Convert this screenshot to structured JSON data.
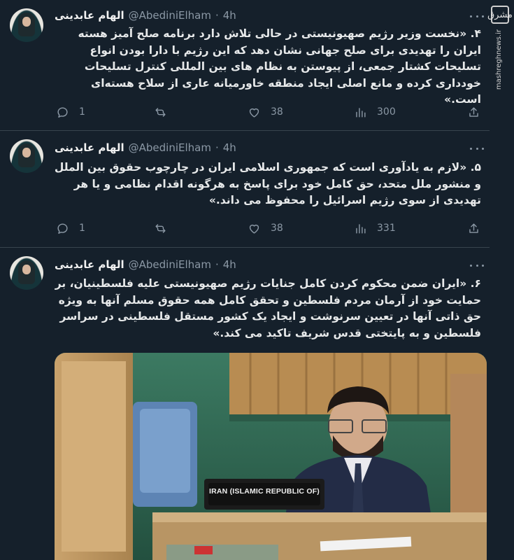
{
  "watermark": {
    "logo_text": "مشرق",
    "site": "mashreghnews.ir"
  },
  "tweets": [
    {
      "author_name": "الهام عابدینی",
      "handle": "@AbediniElham",
      "separator": "·",
      "time": "4h",
      "text": "۴. «نخست وزیر رژیم صهیونیستی در حالی تلاش دارد برنامه صلح آمیز هسته ایران را تهدیدی برای صلح جهانی نشان دهد که این رژیم با دارا بودن انواع تسلیحات کشتار جمعی، از پیوستن به نظام های بین المللی کنترل تسلیحات خودداری کرده و مانع اصلی ایجاد منطقه خاورمیانه عاری از سلاح هسته‌ای است.»",
      "replies": "1",
      "retweets": "",
      "likes": "38",
      "views": "300"
    },
    {
      "author_name": "الهام عابدینی",
      "handle": "@AbediniElham",
      "separator": "·",
      "time": "4h",
      "text": "۵. «لازم به یادآوری است که جمهوری اسلامی ایران در چارچوب حقوق بین الملل و منشور ملل متحد، حق کامل خود برای پاسخ به هرگونه اقدام نظامی و یا هر تهدیدی از سوی رژیم اسرائیل را محفوظ می داند.»",
      "replies": "1",
      "retweets": "",
      "likes": "38",
      "views": "331"
    },
    {
      "author_name": "الهام عابدینی",
      "handle": "@AbediniElham",
      "separator": "·",
      "time": "4h",
      "text": "۶. «ایران ضمن محکوم کردن کامل جنایات رژیم صهیونیستی علیه فلسطینیان، بر حمایت خود از آرمان مردم فلسطین و تحقق کامل همه حقوق مسلم آنها به ویژه حق ذاتی آنها در تعیین سرنوشت و ایجاد یک کشور مستقل فلسطینی در سراسر فلسطین و به پایتختی قدس شریف تاکید می کند.»",
      "media": {
        "nameplate": "IRAN (ISLAMIC REPUBLIC OF)"
      }
    }
  ]
}
